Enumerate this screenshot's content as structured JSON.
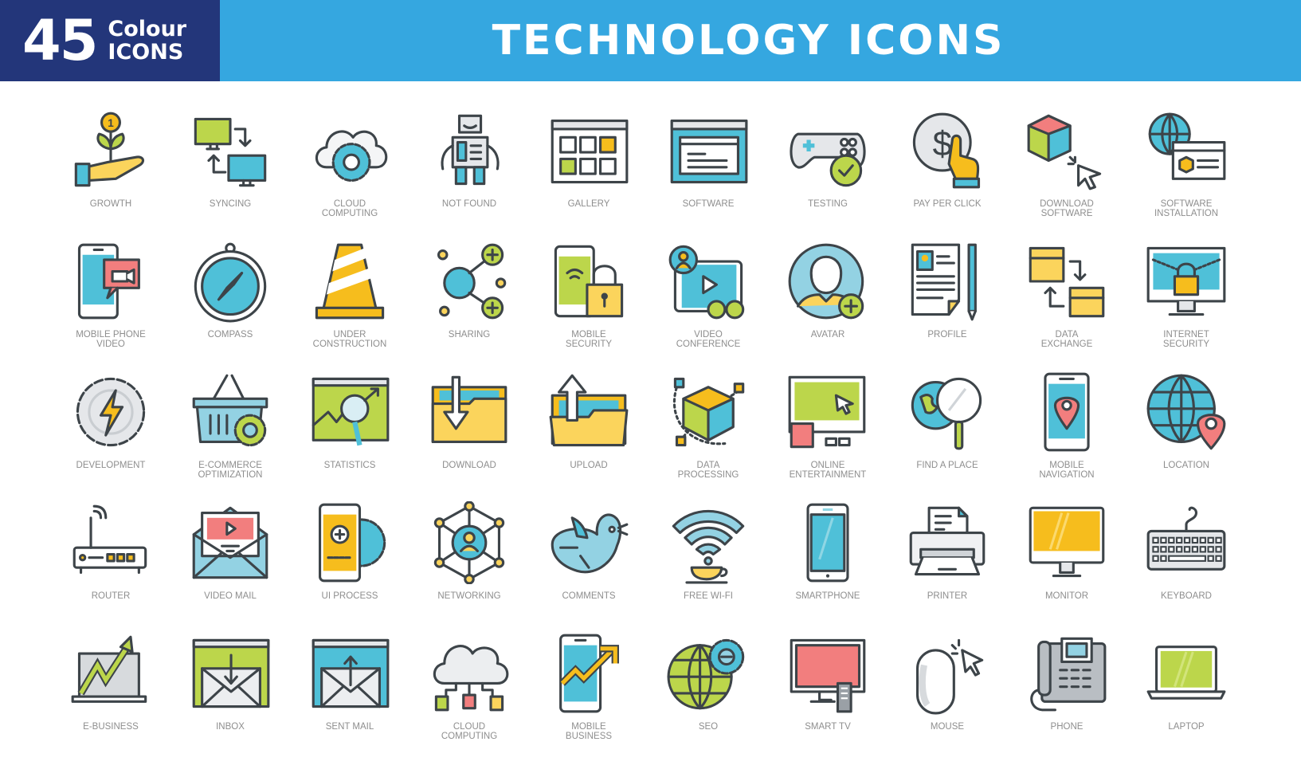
{
  "header": {
    "badge_number": "45",
    "badge_line1": "Colour",
    "badge_line2": "ICONS",
    "title": "TECHNOLOGY ICONS",
    "colors": {
      "badge_bg": "#23367a",
      "banner_bg": "#35a7e0"
    }
  },
  "palette": {
    "stroke": "#3d4449",
    "blue": "#4fc0d8",
    "lightblue": "#93d2e3",
    "green": "#bcd64b",
    "yellow": "#fbd45c",
    "gold": "#f6bd1d",
    "pink": "#f27e7e",
    "grey": "#dcdfe2"
  },
  "icons": [
    {
      "name": "growth",
      "label": "GROWTH"
    },
    {
      "name": "syncing",
      "label": "SYNCING"
    },
    {
      "name": "cloud-computing",
      "label": "CLOUD\nCOMPUTING"
    },
    {
      "name": "not-found",
      "label": "NOT FOUND"
    },
    {
      "name": "gallery",
      "label": "GALLERY"
    },
    {
      "name": "software",
      "label": "SOFTWARE"
    },
    {
      "name": "testing",
      "label": "TESTING"
    },
    {
      "name": "pay-per-click",
      "label": "PAY PER CLICK"
    },
    {
      "name": "download-software",
      "label": "DOWNLOAD\nSOFTWARE"
    },
    {
      "name": "software-installation",
      "label": "SOFTWARE\nINSTALLATION"
    },
    {
      "name": "mobile-phone-video",
      "label": "MOBILE PHONE\nVIDEO"
    },
    {
      "name": "compass",
      "label": "COMPASS"
    },
    {
      "name": "under-construction",
      "label": "UNDER\nCONSTRUCTION"
    },
    {
      "name": "sharing",
      "label": "SHARING"
    },
    {
      "name": "mobile-security",
      "label": "MOBILE\nSECURITY"
    },
    {
      "name": "video-conference",
      "label": "VIDEO\nCONFERENCE"
    },
    {
      "name": "avatar",
      "label": "AVATAR"
    },
    {
      "name": "profile",
      "label": "PROFILE"
    },
    {
      "name": "data-exchange",
      "label": "DATA\nEXCHANGE"
    },
    {
      "name": "internet-security",
      "label": "INTERNET\nSECURITY"
    },
    {
      "name": "development",
      "label": "DEVELOPMENT"
    },
    {
      "name": "e-commerce-optimization",
      "label": "E-COMMERCE\nOPTIMIZATION"
    },
    {
      "name": "statistics",
      "label": "STATISTICS"
    },
    {
      "name": "download",
      "label": "DOWNLOAD"
    },
    {
      "name": "upload",
      "label": "UPLOAD"
    },
    {
      "name": "data-processing",
      "label": "DATA\nPROCESSING"
    },
    {
      "name": "online-entertainment",
      "label": "ONLINE\nENTERTAINMENT"
    },
    {
      "name": "find-a-place",
      "label": "FIND A PLACE"
    },
    {
      "name": "mobile-navigation",
      "label": "MOBILE\nNAVIGATION"
    },
    {
      "name": "location",
      "label": "LOCATION"
    },
    {
      "name": "router",
      "label": "ROUTER"
    },
    {
      "name": "video-mail",
      "label": "VIDEO MAIL"
    },
    {
      "name": "ui-process",
      "label": "UI PROCESS"
    },
    {
      "name": "networking",
      "label": "NETWORKING"
    },
    {
      "name": "comments",
      "label": "COMMENTS"
    },
    {
      "name": "free-wi-fi",
      "label": "FREE WI-FI"
    },
    {
      "name": "smartphone",
      "label": "SMARTPHONE"
    },
    {
      "name": "printer",
      "label": "PRINTER"
    },
    {
      "name": "monitor",
      "label": "MONITOR"
    },
    {
      "name": "keyboard",
      "label": "KEYBOARD"
    },
    {
      "name": "e-business",
      "label": "E-BUSINESS"
    },
    {
      "name": "inbox",
      "label": "INBOX"
    },
    {
      "name": "sent-mail",
      "label": "SENT MAIL"
    },
    {
      "name": "cloud-computing-2",
      "label": "CLOUD\nCOMPUTING"
    },
    {
      "name": "mobile-business",
      "label": "MOBILE\nBUSINESS"
    },
    {
      "name": "seo",
      "label": "SEO"
    },
    {
      "name": "smart-tv",
      "label": "SMART TV"
    },
    {
      "name": "mouse",
      "label": "MOUSE"
    },
    {
      "name": "phone",
      "label": "PHONE"
    },
    {
      "name": "laptop",
      "label": "LAPTOP"
    }
  ]
}
